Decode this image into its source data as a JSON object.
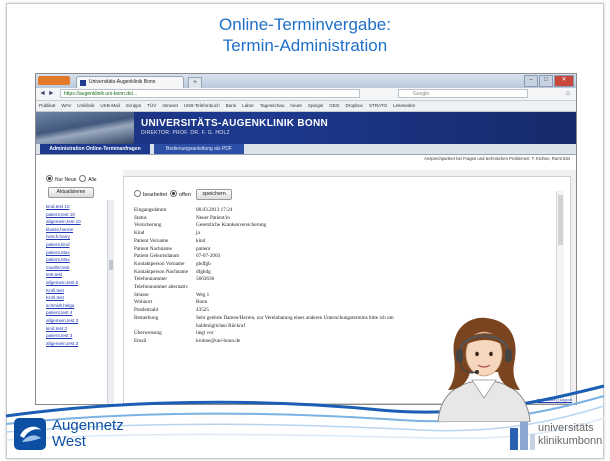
{
  "slide": {
    "title_line1": "Online-Terminvergabe:",
    "title_line2": "Termin-Administration"
  },
  "browser": {
    "tab_title": "Universitäts-Augenklinik Bonn",
    "new_tab": "+",
    "window_controls": [
      "–",
      "□",
      "✕"
    ],
    "nav_icons": "◄ ►",
    "url": "https://augenklinik.uni-bonn.de/...",
    "search_placeholder": "Google",
    "home_icon": "⌂",
    "bookmarks": [
      "Publikat",
      "WAV",
      "Uniklinik",
      "UKB-Mail",
      "Scripps",
      "TÜV",
      "Intranet",
      "UKB-Telefonbuch",
      "Bank",
      "Labor",
      "Tagesschau",
      "heute",
      "Spiegel",
      "GEO",
      "Dropbox",
      "STRATO",
      "Leseseiten"
    ]
  },
  "site": {
    "name": "UNIVERSITÄTS-AUGENKLINIK BONN",
    "director": "DIREKTOR: PROF. DR. F. G. HOLZ",
    "tab_admin": "Administration Online-Terminanfragen",
    "tab_help": "Bedienungsanleitung als PDF",
    "contact": "Ansprechpartner bei Fragen und technischen Problemen: T. Krohne, Rumt 534"
  },
  "sidebar": {
    "filter_new": "Nur Neue",
    "filter_all": "Alle",
    "refresh_button": "Aktualisieren",
    "links": [
      "kind,test 10",
      "patient,test 10",
      "allgemein,test 10",
      "klasse,hanne",
      "hirsch,harry",
      "patient,kind",
      "patient,Max",
      "patient,Max",
      "mueller,test",
      "test,test",
      "allgemein,test 5",
      "Kroll,test",
      "Kroll,test",
      "schmidt,helga",
      "patient,test 4",
      "allgemein,test 3",
      "kind,test 3",
      "patient,test 3",
      "allgemein,test 3"
    ]
  },
  "detail": {
    "status_processed": "bearbeitet",
    "status_open": "offen",
    "save_button": "speichern",
    "rows": [
      {
        "k": "Eingangsdatum",
        "v": "08.03.2013 17:24"
      },
      {
        "k": "Status",
        "v": "Neuer Patient/in"
      },
      {
        "k": "Versicherung",
        "v": "Gesetzliche Krankenversicherung"
      },
      {
        "k": "Kind",
        "v": "ja"
      },
      {
        "k": "Patient Vorname",
        "v": "kind"
      },
      {
        "k": "Patient Nachname",
        "v": "patient"
      },
      {
        "k": "Patient Geburtsdatum",
        "v": "07-07-2003"
      },
      {
        "k": "Kontaktperson Vorname",
        "v": "gbdfgh"
      },
      {
        "k": "Kontaktperson Nachname",
        "v": "dfghdg"
      },
      {
        "k": "Telefonnummer",
        "v": "5663636"
      },
      {
        "k": "Telefonnummer alternativ",
        "v": ""
      },
      {
        "k": "Strasse",
        "v": "Weg 1"
      },
      {
        "k": "Wohnort",
        "v": "Bonn"
      },
      {
        "k": "Postleitzahl",
        "v": "43525"
      },
      {
        "k": "Bemerkung",
        "v": "Sehr geehrte Damen/Herren, zur Vereinbarung eines anderen Unterschungstermins bitte ich um baldmöglichen Rückruf"
      },
      {
        "k": "Überweisung",
        "v": "liegt vor"
      },
      {
        "k": "Email",
        "v": "krohne@uni-bonn.de"
      }
    ],
    "footer_link": "Impressum | Logout"
  },
  "footer": {
    "left_logo_line1": "Augennetz",
    "left_logo_line2": "West",
    "right_logo_line1": "universitäts",
    "right_logo_line2": "klinikumbonn"
  },
  "colors": {
    "title_blue": "#1f6fc8",
    "site_navy": "#1d3a8f",
    "link_blue": "#2139b5",
    "logo_blue": "#0d4fa3"
  }
}
